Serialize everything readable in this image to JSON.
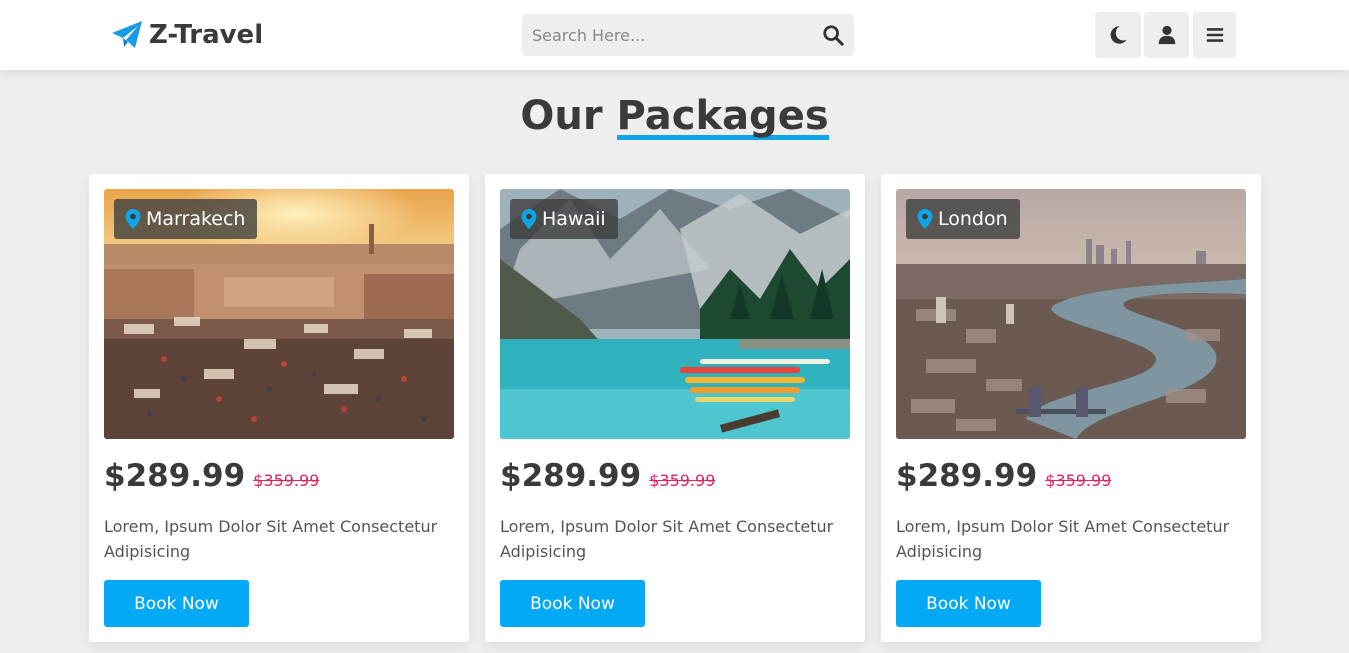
{
  "header": {
    "logo_text": "Z-Travel",
    "search_placeholder": "Search Here...",
    "search_value": ""
  },
  "section": {
    "title_plain": "Our ",
    "title_highlight": "Packages"
  },
  "packages": [
    {
      "location": "Marrakech",
      "price": "$289.99",
      "old_price": "$359.99",
      "description": "Lorem, Ipsum Dolor Sit Amet Consectetur Adipisicing",
      "button_label": "Book Now"
    },
    {
      "location": "Hawaii",
      "price": "$289.99",
      "old_price": "$359.99",
      "description": "Lorem, Ipsum Dolor Sit Amet Consectetur Adipisicing",
      "button_label": "Book Now"
    },
    {
      "location": "London",
      "price": "$289.99",
      "old_price": "$359.99",
      "description": "Lorem, Ipsum Dolor Sit Amet Consectetur Adipisicing",
      "button_label": "Book Now"
    }
  ],
  "icons": {
    "logo": "paper-plane-icon",
    "search": "search-icon",
    "theme": "moon-icon",
    "user": "user-icon",
    "menu": "hamburger-menu-icon",
    "location": "map-marker-icon"
  },
  "colors": {
    "accent": "#03a9f4",
    "old_price": "#e0245e",
    "text_dark": "#3a3a3a",
    "background": "#eeeeee"
  }
}
